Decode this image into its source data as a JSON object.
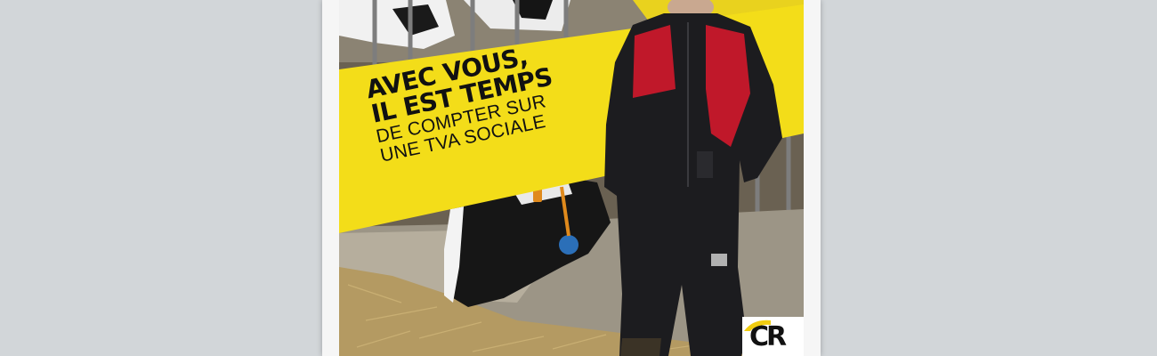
{
  "poster": {
    "headline": {
      "line1": "AVEC VOUS,",
      "line2": "IL EST TEMPS",
      "line3": "DE COMPTER SUR",
      "line4": "UNE TVA SOCIALE"
    },
    "logo": {
      "text": "CR"
    }
  },
  "colors": {
    "background": "#d2d6d9",
    "banner_yellow": "#f3dd19",
    "overalls_red": "#c0182a",
    "overalls_black": "#1c1c1f",
    "logo_yellow": "#f0cc10"
  }
}
